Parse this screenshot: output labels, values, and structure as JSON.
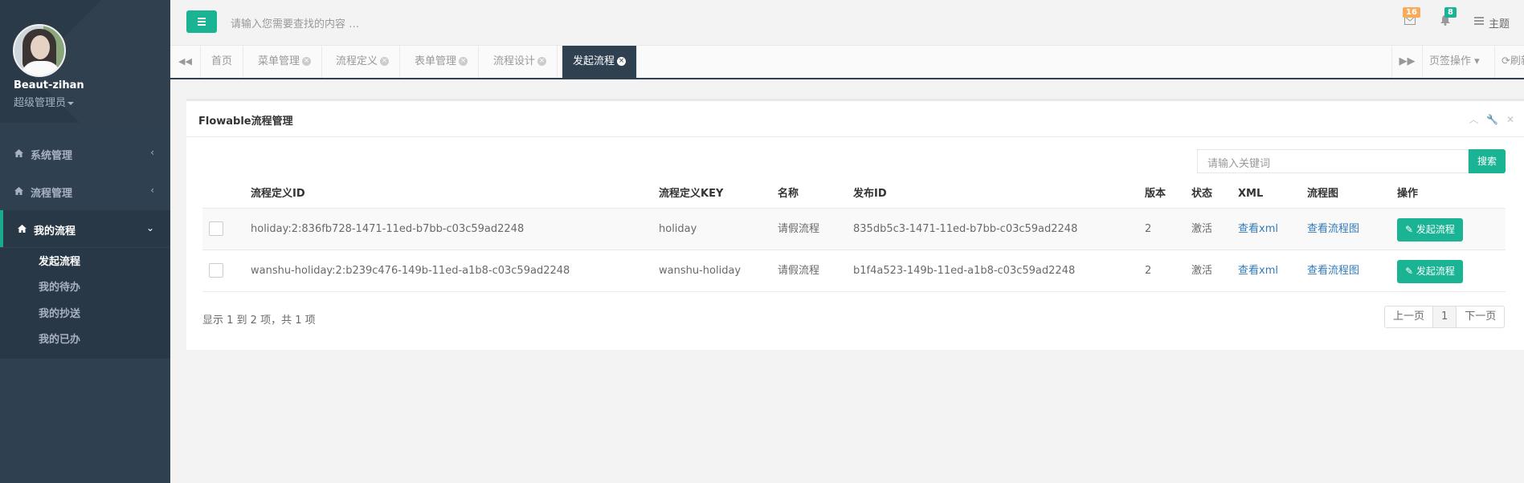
{
  "user": {
    "name": "Beaut-zihan",
    "role": "超级管理员"
  },
  "sidebar": {
    "items": [
      {
        "label": "系统管理",
        "arrow": "‹"
      },
      {
        "label": "流程管理",
        "arrow": "‹"
      },
      {
        "label": "我的流程",
        "arrow": "⌄"
      }
    ],
    "sub_items": [
      "发起流程",
      "我的待办",
      "我的抄送",
      "我的已办"
    ]
  },
  "topbar": {
    "search_placeholder": "请输入您需要查找的内容 …",
    "mail_badge": "16",
    "bell_badge": "8",
    "theme_label": "主题"
  },
  "tabs": {
    "items": [
      "首页",
      "菜单管理",
      "流程定义",
      "表单管理",
      "流程设计",
      "发起流程"
    ],
    "page_ops": "页签操作",
    "refresh": "刷新"
  },
  "panel": {
    "title": "Flowable流程管理",
    "search_placeholder": "请输入关键词",
    "search_button": "搜索",
    "columns": [
      "流程定义ID",
      "流程定义KEY",
      "名称",
      "发布ID",
      "版本",
      "状态",
      "XML",
      "流程图",
      "操作"
    ],
    "rows": [
      {
        "id": "holiday:2:836fb728-1471-11ed-b7bb-c03c59ad2248",
        "key": "holiday",
        "name": "请假流程",
        "deploy_id": "835db5c3-1471-11ed-b7bb-c03c59ad2248",
        "version": "2",
        "status": "激活",
        "xml": "查看xml",
        "diagram": "查看流程图",
        "action": "发起流程"
      },
      {
        "id": "wanshu-holiday:2:b239c476-149b-11ed-a1b8-c03c59ad2248",
        "key": "wanshu-holiday",
        "name": "请假流程",
        "deploy_id": "b1f4a523-149b-11ed-a1b8-c03c59ad2248",
        "version": "2",
        "status": "激活",
        "xml": "查看xml",
        "diagram": "查看流程图",
        "action": "发起流程"
      }
    ],
    "info": "显示 1 到 2 项，共 1 项",
    "pager": {
      "prev": "上一页",
      "current": "1",
      "next": "下一页"
    }
  },
  "colors": {
    "sidebar": "#2f4050",
    "accent": "#1ab394",
    "badge_orange": "#f8ac59",
    "badge_green": "#1ab394"
  }
}
